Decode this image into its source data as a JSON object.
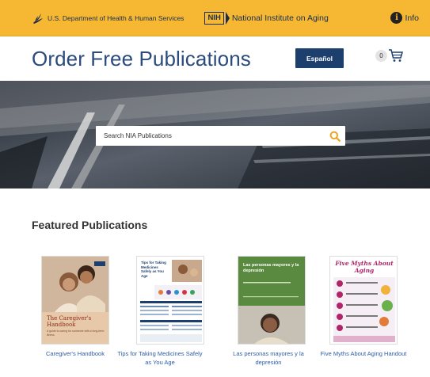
{
  "gov_bar": {
    "hhs_label": "U.S. Department of Health & Human Services",
    "nih_label": "NIH",
    "nia_label": "National Institute on Aging",
    "info_label": "Info",
    "accent_color": "#f6b832"
  },
  "header": {
    "title": "Order Free Publications",
    "espanol_label": "Español",
    "cart_count": "0",
    "title_color": "#2b4a7d"
  },
  "search": {
    "placeholder": "Search NIA Publications"
  },
  "featured": {
    "heading": "Featured Publications",
    "items": [
      {
        "title": "Caregiver's Handbook",
        "cover_title": "The Caregiver's Handbook",
        "cover_subtitle": "A guide to caring for someone with a long-term illness"
      },
      {
        "title": "Tips for Taking Medicines Safely as You Age",
        "cover_title": "Tips for Taking Medicines Safely as You Age"
      },
      {
        "title": "Las personas mayores y la depresión",
        "cover_title": "Las personas mayores y la depresión"
      },
      {
        "title": "Five Myths About Aging Handout",
        "cover_title": "Five Myths About Aging"
      }
    ]
  }
}
